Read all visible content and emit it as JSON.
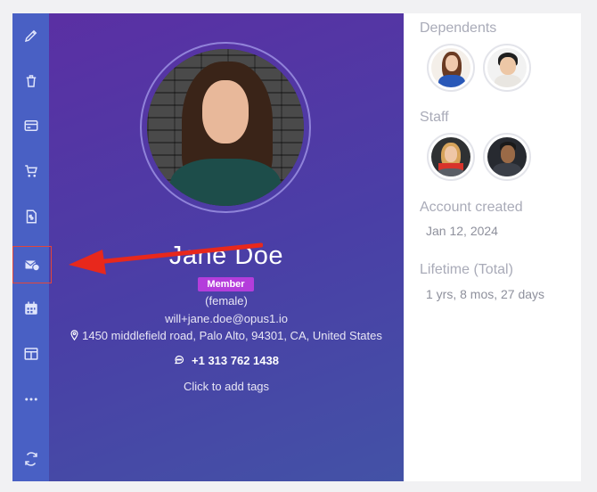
{
  "profile": {
    "name": "Jane Doe",
    "badge": "Member",
    "gender": "(female)",
    "email": "will+jane.doe@opus1.io",
    "address": "1450 middlefield road, Palo Alto, 94301, CA, United States",
    "phone": "+1 313 762 1438",
    "tags_prompt": "Click to add tags"
  },
  "right_panel": {
    "dependents_label": "Dependents",
    "staff_label": "Staff",
    "account_created_label": "Account created",
    "account_created_value": "Jan 12, 2024",
    "lifetime_label": "Lifetime (Total)",
    "lifetime_value": "1 yrs, 8 mos, 27 days"
  },
  "rail_icons": [
    {
      "name": "pencil-icon"
    },
    {
      "name": "trash-icon"
    },
    {
      "name": "credit-card-icon"
    },
    {
      "name": "cart-icon"
    },
    {
      "name": "invoice-icon"
    },
    {
      "name": "mail-clock-icon",
      "active": true
    },
    {
      "name": "calendar-icon"
    },
    {
      "name": "layout-icon"
    },
    {
      "name": "more-icon"
    },
    {
      "name": "refresh-icon"
    }
  ],
  "colors": {
    "rail": "#4960c4",
    "gradient_start": "#5b2fa3",
    "gradient_end": "#4352a6",
    "badge": "#b43ddb",
    "annotation_arrow": "#e8281c"
  }
}
